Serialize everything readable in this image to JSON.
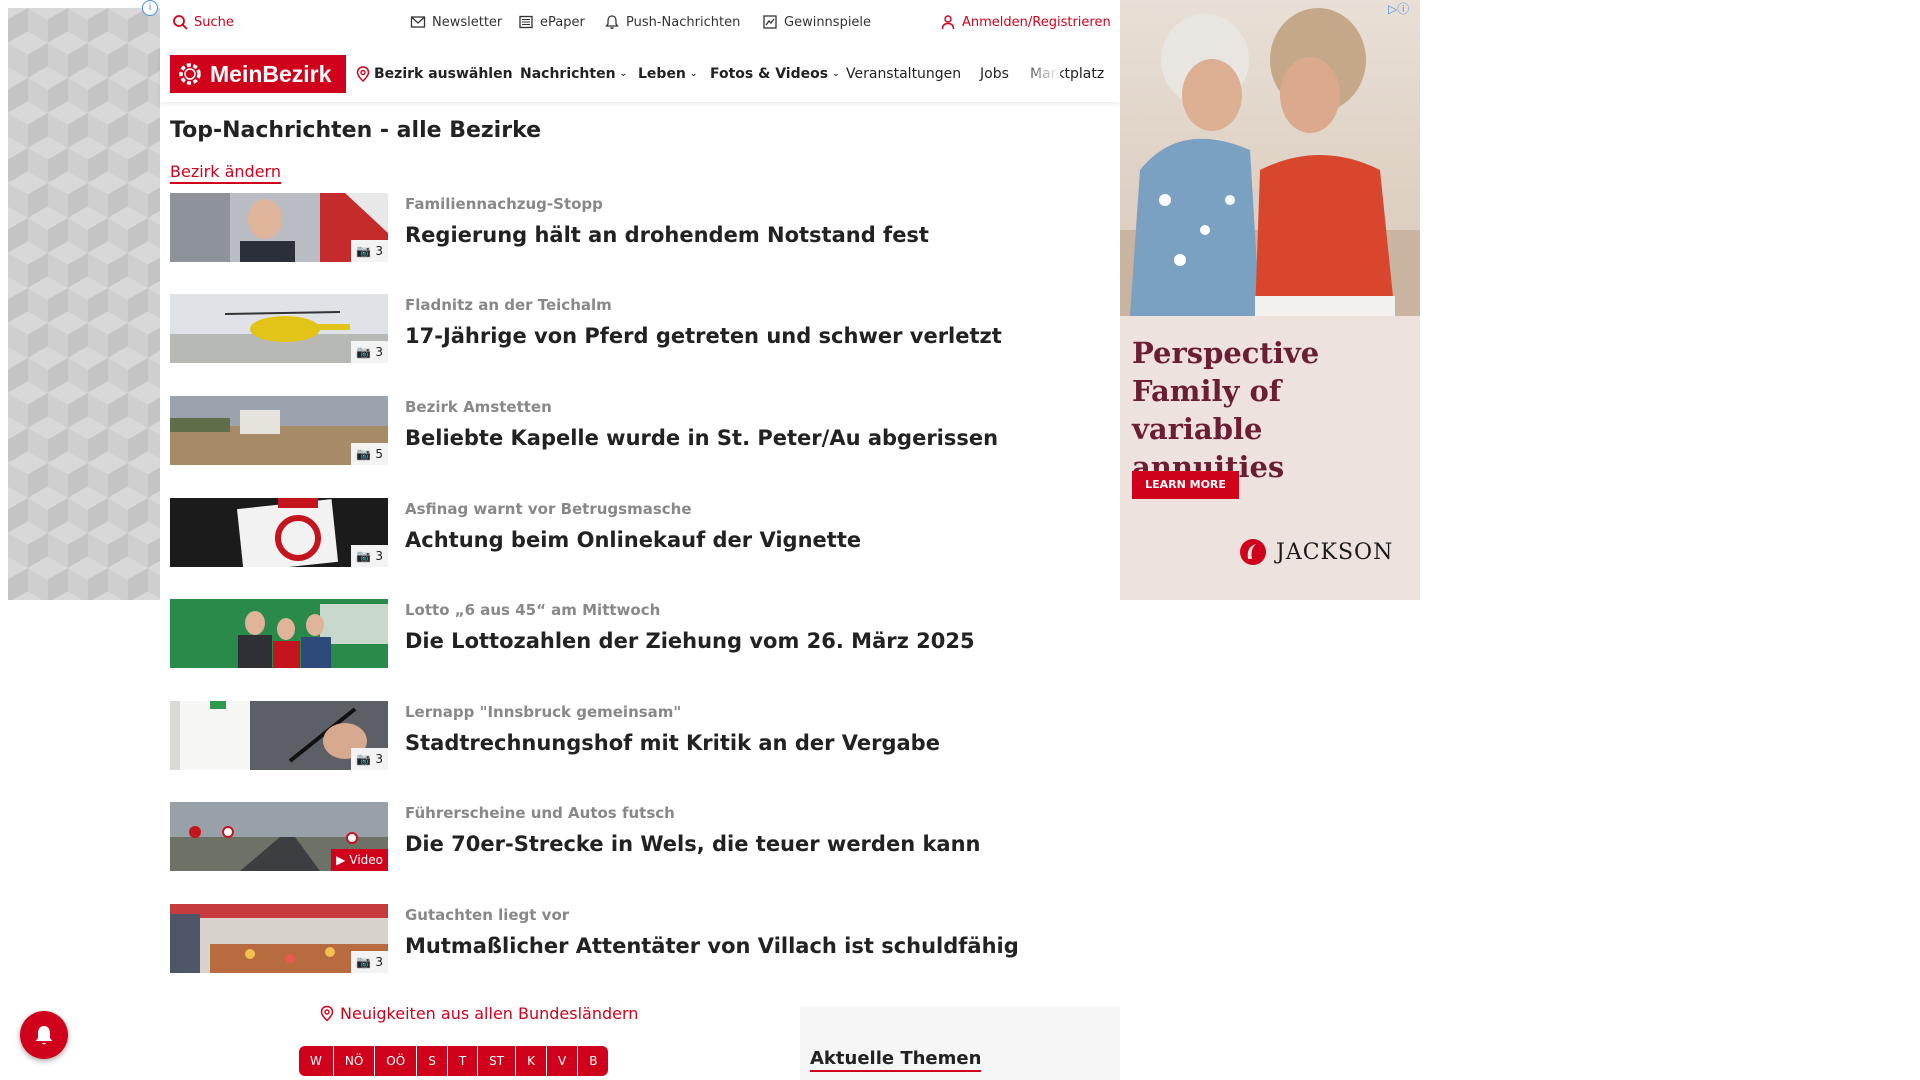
{
  "utility": {
    "search": "Suche",
    "newsletter": "Newsletter",
    "epaper": "ePaper",
    "push": "Push-Nachrichten",
    "contests": "Gewinnspiele",
    "login": "Anmelden/Registrieren"
  },
  "nav": {
    "logo": "MeinBezirk",
    "select_district": "Bezirk auswählen",
    "items": [
      "Nachrichten",
      "Leben",
      "Fotos & Videos",
      "Veranstaltungen",
      "Jobs",
      "Marktplatz"
    ]
  },
  "page": {
    "title": "Top-Nachrichten - alle Bezirke",
    "change_district": "Bezirk ändern"
  },
  "articles": [
    {
      "kicker": "Familiennachzug-Stopp",
      "title": "Regierung hält an drohendem Notstand fest",
      "badge": "3",
      "type": "gallery"
    },
    {
      "kicker": "Fladnitz an der Teichalm",
      "title": "17-Jährige von Pferd getreten und schwer verletzt",
      "badge": "3",
      "type": "gallery"
    },
    {
      "kicker": "Bezirk Amstetten",
      "title": "Beliebte Kapelle wurde in St. Peter/Au abgerissen",
      "badge": "5",
      "type": "gallery"
    },
    {
      "kicker": "Asfinag warnt vor Betrugsmasche",
      "title": "Achtung beim Onlinekauf der Vignette",
      "badge": "3",
      "type": "gallery"
    },
    {
      "kicker": "Lotto „6 aus 45“ am Mittwoch",
      "title": "Die Lottozahlen der Ziehung vom 26. März 2025",
      "badge": "",
      "type": "none"
    },
    {
      "kicker": "Lernapp \"Innsbruck gemeinsam\"",
      "title": "Stadtrechnungshof mit Kritik an der Vergabe",
      "badge": "3",
      "type": "gallery"
    },
    {
      "kicker": "Führerscheine und Autos futsch",
      "title": "Die 70er-Strecke in Wels, die teuer werden kann",
      "badge": "Video",
      "type": "video"
    },
    {
      "kicker": "Gutachten liegt vor",
      "title": "Mutmaßlicher Attentäter von Villach ist schuldfähig",
      "badge": "3",
      "type": "gallery"
    }
  ],
  "states": {
    "link": "Neuigkeiten aus allen Bundesländern",
    "buttons": [
      "W",
      "NÖ",
      "OÖ",
      "S",
      "T",
      "ST",
      "K",
      "V",
      "B"
    ]
  },
  "topics": {
    "title": "Aktuelle Themen"
  },
  "ad": {
    "headline": "Perspective Family of variable annuities",
    "cta": "LEARN MORE",
    "brand": "JACKSON",
    "choices_icon": "ad-choices-icon"
  },
  "colors": {
    "accent": "#d0021b",
    "ad_headline": "#6b1e33",
    "ad_bg": "#eee2de"
  }
}
